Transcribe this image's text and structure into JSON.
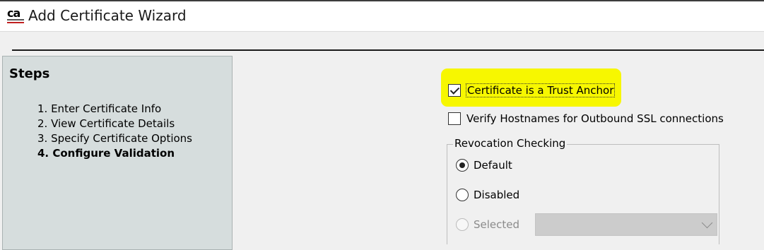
{
  "window": {
    "title": "Add Certificate Wizard",
    "logo_text": "ca"
  },
  "steps": {
    "heading": "Steps",
    "items": [
      {
        "label": "1. Enter Certificate Info",
        "current": false
      },
      {
        "label": "2. View Certificate Details",
        "current": false
      },
      {
        "label": "3. Specify Certificate Options",
        "current": false
      },
      {
        "label": "4. Configure Validation",
        "current": true
      }
    ]
  },
  "options": {
    "trust_anchor": {
      "label": "Certificate is a Trust Anchor",
      "checked": true,
      "highlight_color": "#f7f700"
    },
    "verify_hostnames": {
      "label": "Verify Hostnames for Outbound SSL connections",
      "checked": false
    }
  },
  "revocation": {
    "legend": "Revocation Checking",
    "options": [
      {
        "label": "Default",
        "selected": true,
        "enabled": true
      },
      {
        "label": "Disabled",
        "selected": false,
        "enabled": true
      },
      {
        "label": "Selected",
        "selected": false,
        "enabled": false
      }
    ],
    "dropdown_value": ""
  }
}
